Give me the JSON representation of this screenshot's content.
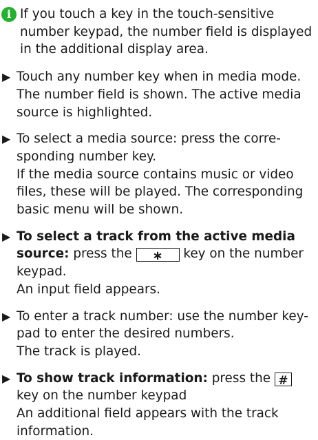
{
  "note": {
    "icon": "info-icon",
    "lines": [
      "If you touch a key in the touch-sensitive",
      "number keypad, the number field is displayed",
      "in the additional display area."
    ]
  },
  "steps": [
    {
      "lines": [
        "Touch any number key when in media mode.",
        "The number field is shown. The active media",
        "source is highlighted."
      ]
    },
    {
      "lines": [
        "To select a media source: press the corre-",
        "sponding number key.",
        "If the media source contains music or video",
        "files, these will be played. The corresponding",
        "basic menu will be shown."
      ]
    },
    {
      "bold_line1": "To select a track from the active media",
      "bold_line2": "source:",
      "text_before_key": " press the ",
      "key": "∗",
      "text_after_key": " key on the number",
      "lines_after": [
        "keypad.",
        "An input field appears."
      ]
    },
    {
      "lines": [
        "To enter a track number: use the number key-",
        "pad to enter the desired numbers.",
        "The track is played."
      ]
    },
    {
      "bold_lead": "To show track information:",
      "text_before_key": " press the ",
      "key": "#",
      "lines_after": [
        "key on the number keypad",
        "An additional field appears with the track",
        "information."
      ]
    }
  ]
}
